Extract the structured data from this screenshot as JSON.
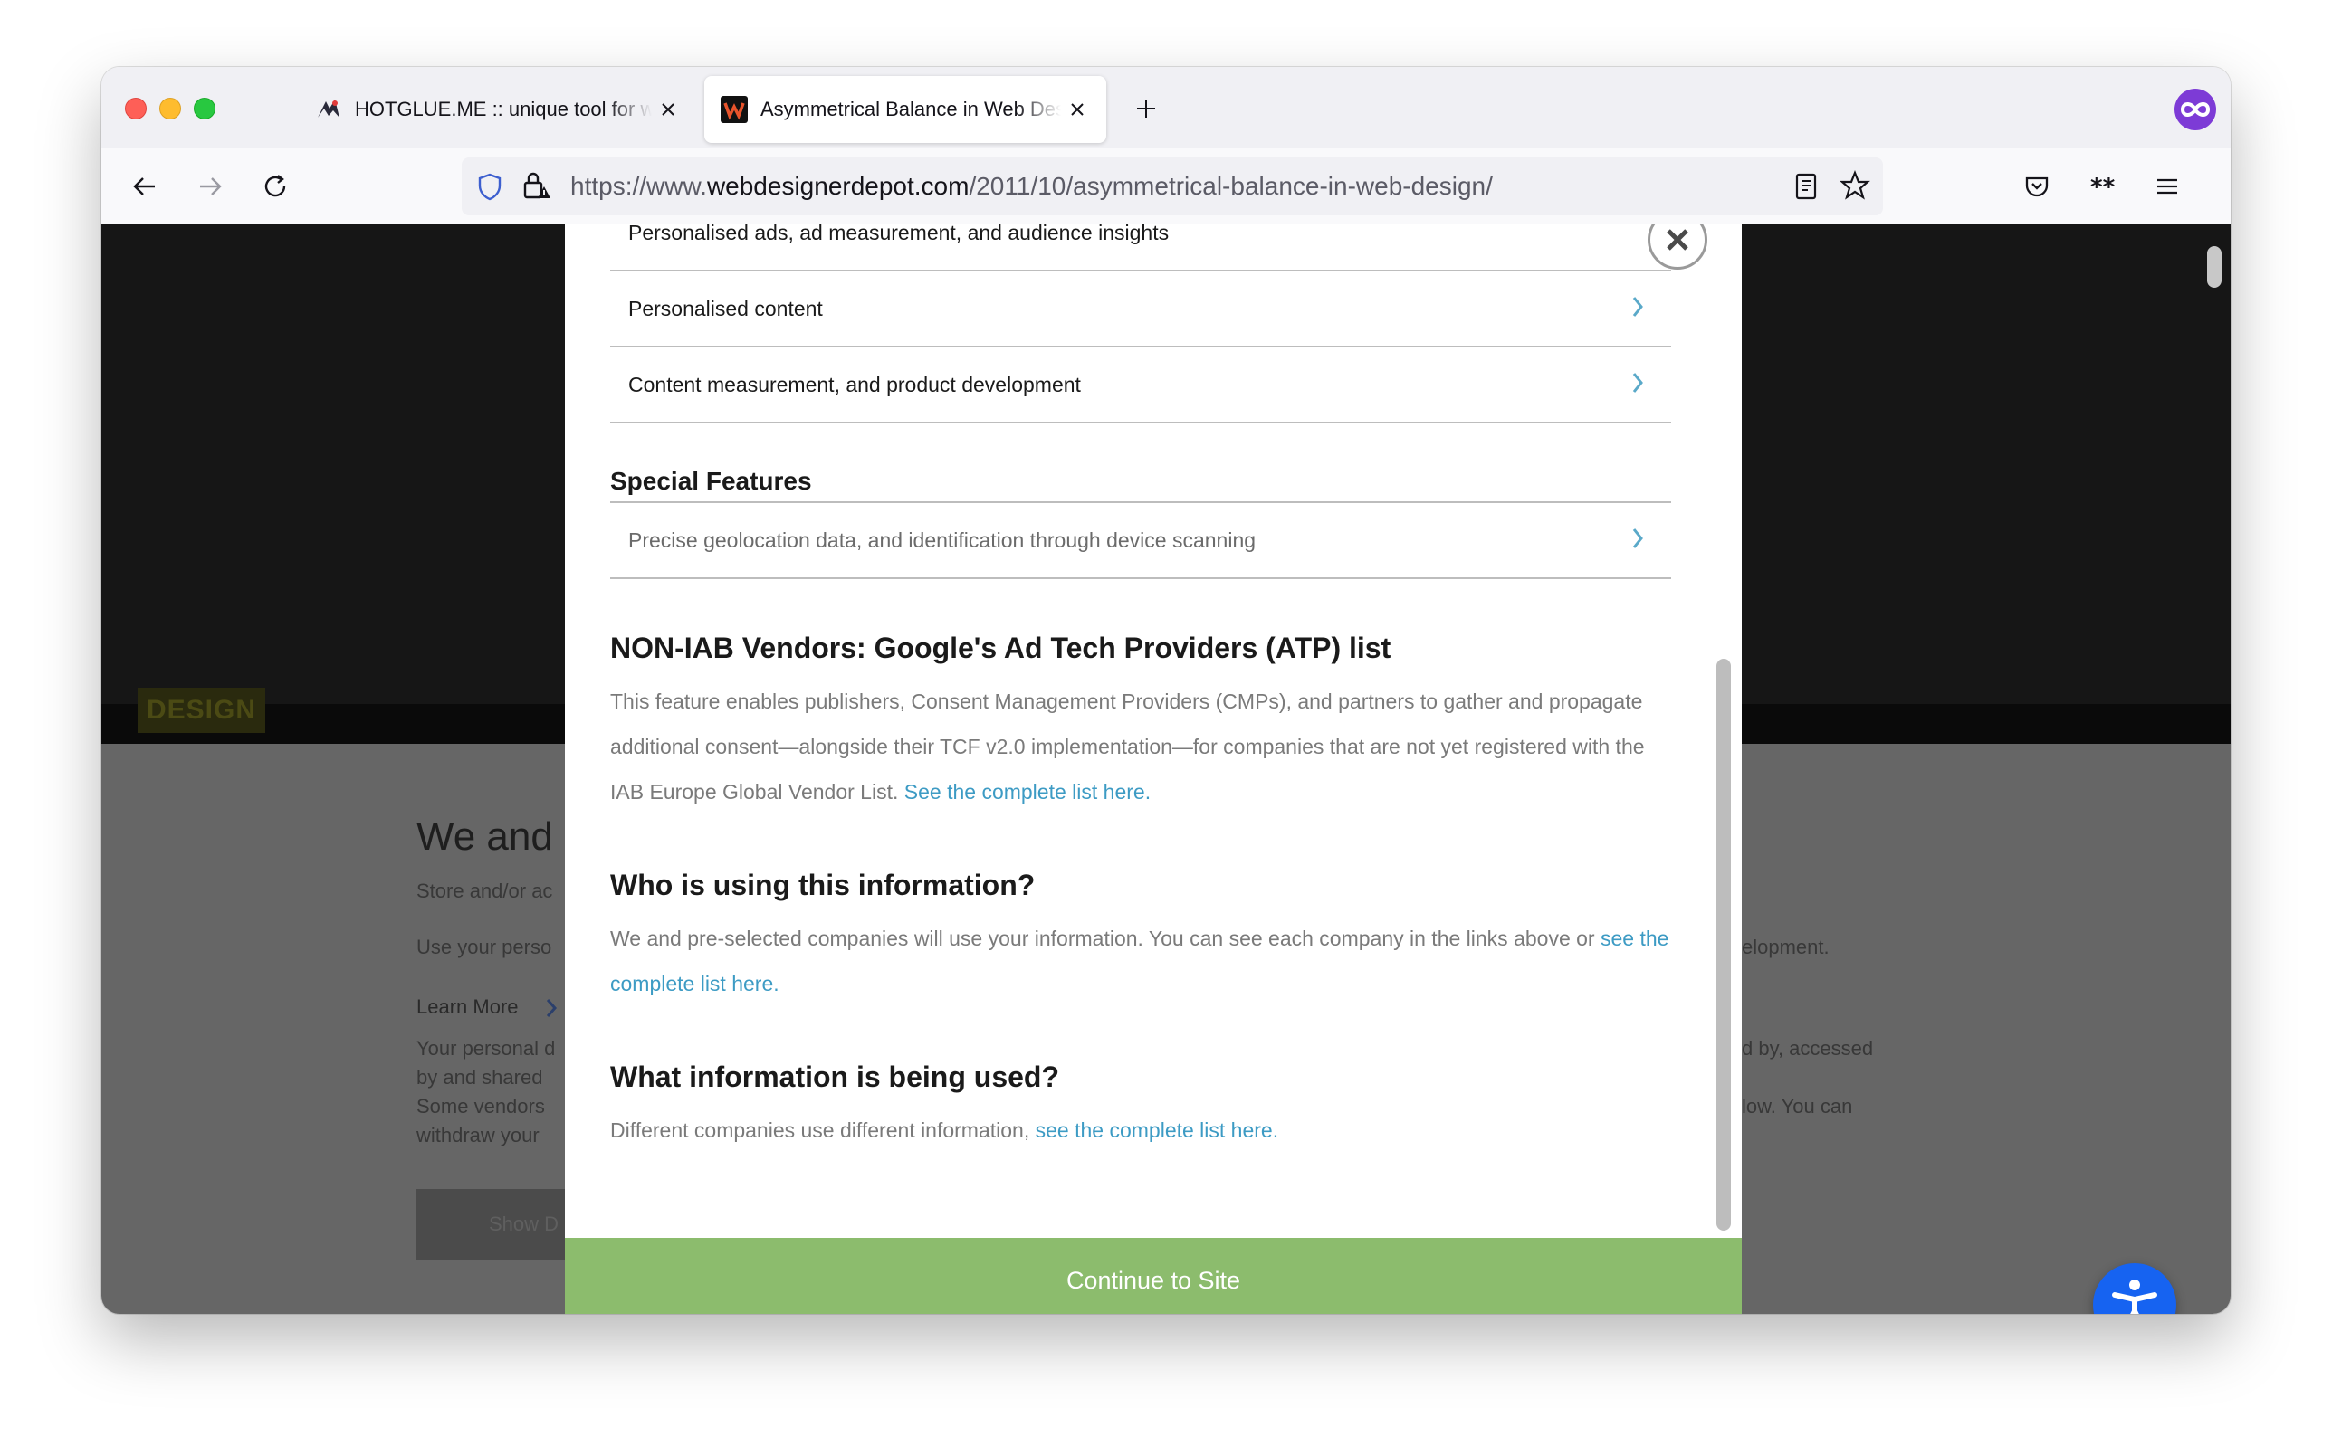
{
  "tabs": [
    {
      "title": "HOTGLUE.ME :: unique tool for web",
      "active": false
    },
    {
      "title": "Asymmetrical Balance in Web Design",
      "active": true
    }
  ],
  "url": {
    "prefix": "https://www.",
    "domain": "webdesignerdepot.com",
    "path": "/2011/10/asymmetrical-balance-in-web-design/"
  },
  "background": {
    "tag": "DESIGN",
    "heading": "We and",
    "lines": [
      "Store and/or ac",
      "Use your perso",
      "Learn More",
      "Your personal d",
      "by and shared",
      "Some vendors",
      "withdraw your"
    ],
    "right_lines": [
      "elopment.",
      "d by, accessed",
      "low. You can"
    ],
    "button": "Show D"
  },
  "modal": {
    "purposes": [
      "Personalised ads, ad measurement, and audience insights",
      "Personalised content",
      "Content measurement, and product development"
    ],
    "special_heading": "Special Features",
    "special_items": [
      "Precise geolocation data, and identification through device scanning"
    ],
    "nonia_heading": "NON-IAB Vendors: Google's Ad Tech Providers (ATP) list",
    "nonia_text": "This feature enables publishers, Consent Management Providers (CMPs), and partners to gather and propagate additional consent—alongside their TCF v2.0 implementation—for companies that are not yet registered with the IAB Europe Global Vendor List.",
    "nonia_link": "See the complete list here.",
    "who_heading": "Who is using this information?",
    "who_text": "We and pre-selected companies will use your information. You can see each company in the links above or",
    "who_link": "see the complete list here.",
    "what_heading": "What information is being used?",
    "what_text": "Different companies use different information,",
    "what_link": "see the complete list here.",
    "continue_label": "Continue to Site"
  },
  "colors": {
    "accent_link": "#3d9bc4",
    "continue_bg": "#8cbc6d",
    "a11y_bg": "#1663f1"
  }
}
